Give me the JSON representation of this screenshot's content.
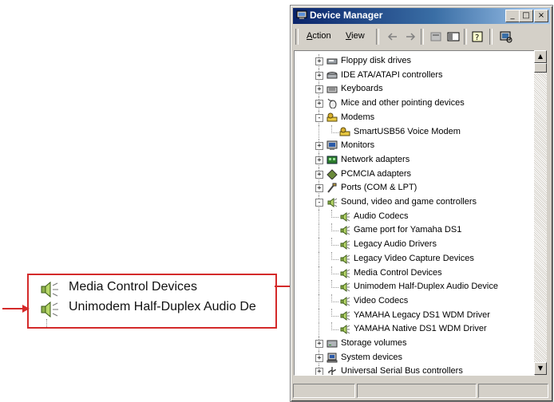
{
  "window": {
    "title": "Device Manager",
    "controls": {
      "minimize": "_",
      "maximize": "□",
      "close": "×"
    }
  },
  "menu": {
    "action": "Action",
    "view": "View"
  },
  "tree": [
    {
      "label": "Floppy disk drives",
      "level": 0,
      "expander": "+",
      "icon": "floppy-icon"
    },
    {
      "label": "IDE ATA/ATAPI controllers",
      "level": 0,
      "expander": "+",
      "icon": "ide-controller-icon"
    },
    {
      "label": "Keyboards",
      "level": 0,
      "expander": "+",
      "icon": "keyboard-icon"
    },
    {
      "label": "Mice and other pointing devices",
      "level": 0,
      "expander": "+",
      "icon": "mouse-icon"
    },
    {
      "label": "Modems",
      "level": 0,
      "expander": "-",
      "icon": "modem-icon"
    },
    {
      "label": "SmartUSB56 Voice Modem",
      "level": 1,
      "expander": "",
      "icon": "modem-icon"
    },
    {
      "label": "Monitors",
      "level": 0,
      "expander": "+",
      "icon": "monitor-icon"
    },
    {
      "label": "Network adapters",
      "level": 0,
      "expander": "+",
      "icon": "network-adapter-icon"
    },
    {
      "label": "PCMCIA adapters",
      "level": 0,
      "expander": "+",
      "icon": "pcmcia-icon"
    },
    {
      "label": "Ports (COM & LPT)",
      "level": 0,
      "expander": "+",
      "icon": "port-icon"
    },
    {
      "label": "Sound, video and game controllers",
      "level": 0,
      "expander": "-",
      "icon": "speaker-icon"
    },
    {
      "label": "Audio Codecs",
      "level": 1,
      "expander": "",
      "icon": "speaker-icon"
    },
    {
      "label": "Game port for Yamaha DS1",
      "level": 1,
      "expander": "",
      "icon": "speaker-icon"
    },
    {
      "label": "Legacy Audio Drivers",
      "level": 1,
      "expander": "",
      "icon": "speaker-icon"
    },
    {
      "label": "Legacy Video Capture Devices",
      "level": 1,
      "expander": "",
      "icon": "speaker-icon"
    },
    {
      "label": "Media Control Devices",
      "level": 1,
      "expander": "",
      "icon": "speaker-icon"
    },
    {
      "label": "Unimodem Half-Duplex Audio Device",
      "level": 1,
      "expander": "",
      "icon": "speaker-icon"
    },
    {
      "label": "Video Codecs",
      "level": 1,
      "expander": "",
      "icon": "speaker-icon"
    },
    {
      "label": "YAMAHA Legacy DS1 WDM Driver",
      "level": 1,
      "expander": "",
      "icon": "speaker-icon"
    },
    {
      "label": "YAMAHA Native DS1 WDM Driver",
      "level": 1,
      "expander": "",
      "icon": "speaker-icon"
    },
    {
      "label": "Storage volumes",
      "level": 0,
      "expander": "+",
      "icon": "storage-icon"
    },
    {
      "label": "System devices",
      "level": 0,
      "expander": "+",
      "icon": "computer-icon"
    },
    {
      "label": "Universal Serial Bus controllers",
      "level": 0,
      "expander": "+",
      "icon": "usb-icon"
    }
  ],
  "zoom": {
    "items": [
      {
        "label": "Media Control Devices",
        "icon": "speaker-icon"
      },
      {
        "label": "Unimodem Half-Duplex Audio De",
        "icon": "speaker-icon"
      }
    ]
  },
  "colors": {
    "callout": "#d42a2a",
    "titlebar": "#0a246a",
    "selection_arrow": "#d42a2a"
  }
}
